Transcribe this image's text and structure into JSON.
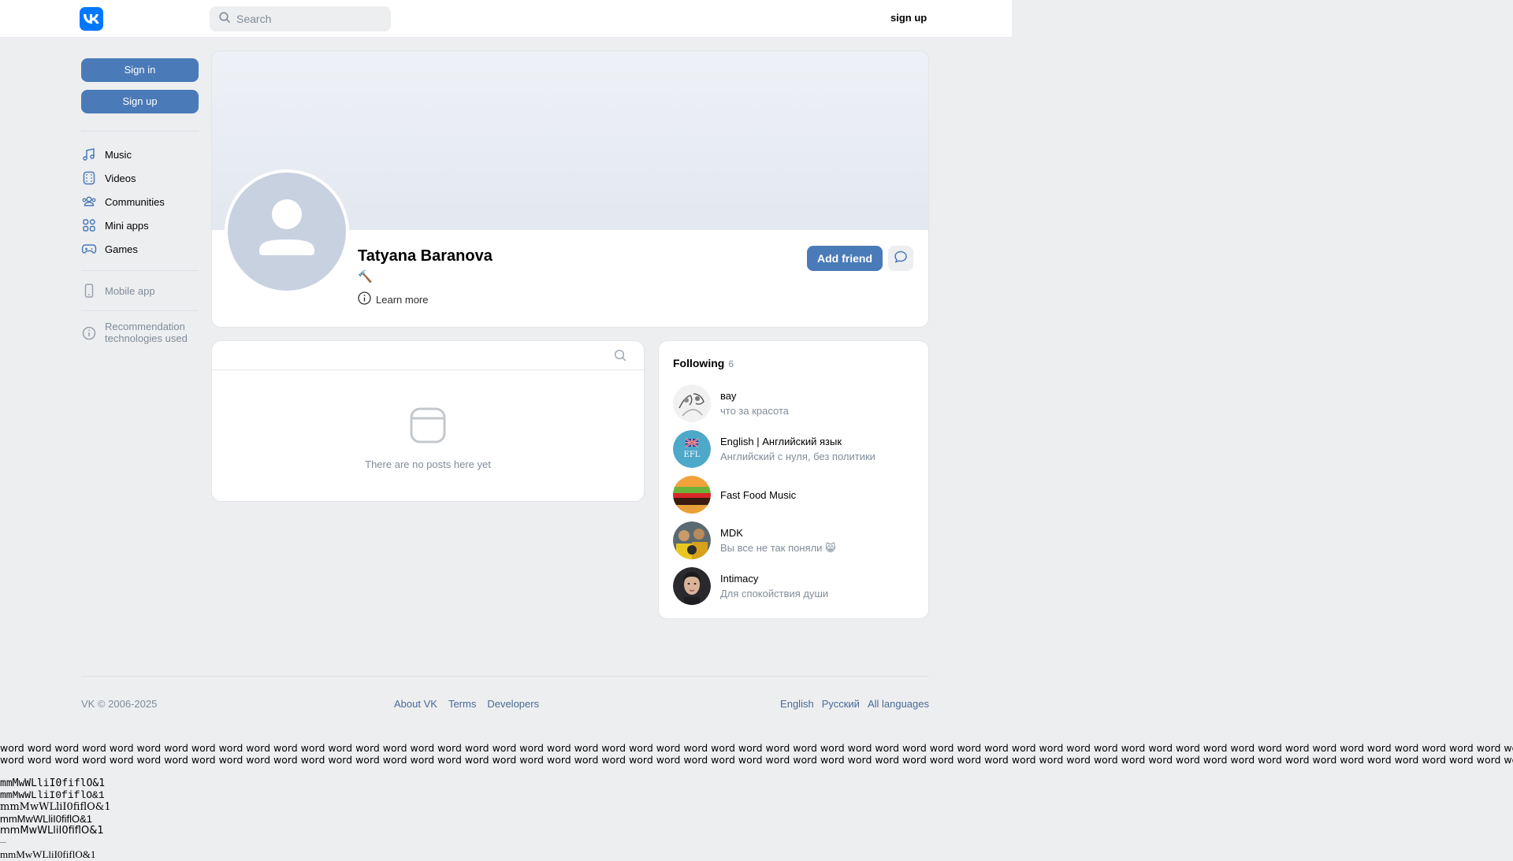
{
  "header": {
    "search_placeholder": "Search",
    "signup_label": "sign up"
  },
  "sidebar": {
    "signin_label": "Sign in",
    "signup_label": "Sign up",
    "items": [
      {
        "label": "Music",
        "icon": "music-icon"
      },
      {
        "label": "Videos",
        "icon": "video-icon"
      },
      {
        "label": "Communities",
        "icon": "communities-icon"
      },
      {
        "label": "Mini apps",
        "icon": "mini-apps-icon"
      },
      {
        "label": "Games",
        "icon": "gamepad-icon"
      }
    ],
    "mobile_app": "Mobile app",
    "recommendation": "Recommendation technologies used"
  },
  "profile": {
    "name": "Tatyana Baranova",
    "status": "🔨",
    "learn_more": "Learn more",
    "add_friend": "Add friend"
  },
  "posts": {
    "empty_text": "There are no posts here yet"
  },
  "following": {
    "title": "Following",
    "count": "6",
    "items": [
      {
        "name": "вау",
        "sub": "что за красота"
      },
      {
        "name": "English | Английский язык",
        "sub": "Английский с нуля, без политики"
      },
      {
        "name": "Fast Food Music",
        "sub": ""
      },
      {
        "name": "MDK",
        "sub": "Вы все не так поняли 😸"
      },
      {
        "name": "Intimacy",
        "sub": "Для спокойствия души"
      }
    ]
  },
  "footer": {
    "copyright": "VK © 2006-2025",
    "links": [
      "About VK",
      "Terms",
      "Developers"
    ],
    "langs": [
      "English",
      "Русский",
      "All languages"
    ]
  },
  "fonttest": {
    "words_line": "word word word word word word word word word word word word word word word word word word word word word word word word word word word word word word word word word word word word word word word word word word word word word word word word word word word word word word word word word word word word word word word word",
    "sample": "mmMwWLliI0fiflO&1"
  },
  "colors": {
    "accent": "#4a7ab8",
    "vk_blue": "#0077ff",
    "background": "#edeef0"
  }
}
